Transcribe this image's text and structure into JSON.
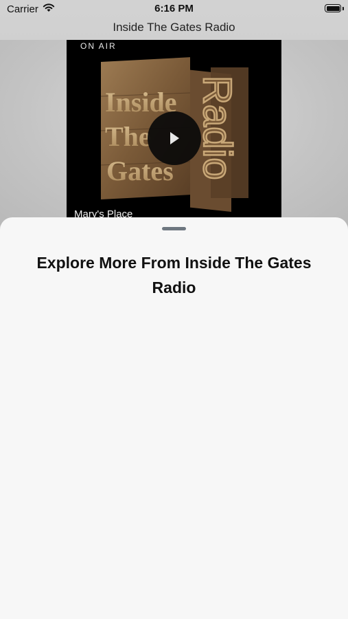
{
  "status_bar": {
    "carrier": "Carrier",
    "time": "6:16 PM",
    "battery_level": 1.0
  },
  "nav": {
    "title": "Inside The Gates Radio"
  },
  "player": {
    "on_air_label": "ON AIR",
    "show_name": "Mary's Place",
    "artwork_text": [
      "Inside",
      "The",
      "Gates",
      "Radio"
    ]
  },
  "sheet": {
    "title": "Explore More From Inside The Gates Radio"
  },
  "icons": {
    "wifi": "wifi-icon",
    "battery": "battery-icon",
    "play": "play-icon"
  },
  "colors": {
    "sheet_background": "#f7f7f7",
    "grabber": "#6e7780",
    "artwork_background": "#000000",
    "wood": "#8a6a45"
  }
}
